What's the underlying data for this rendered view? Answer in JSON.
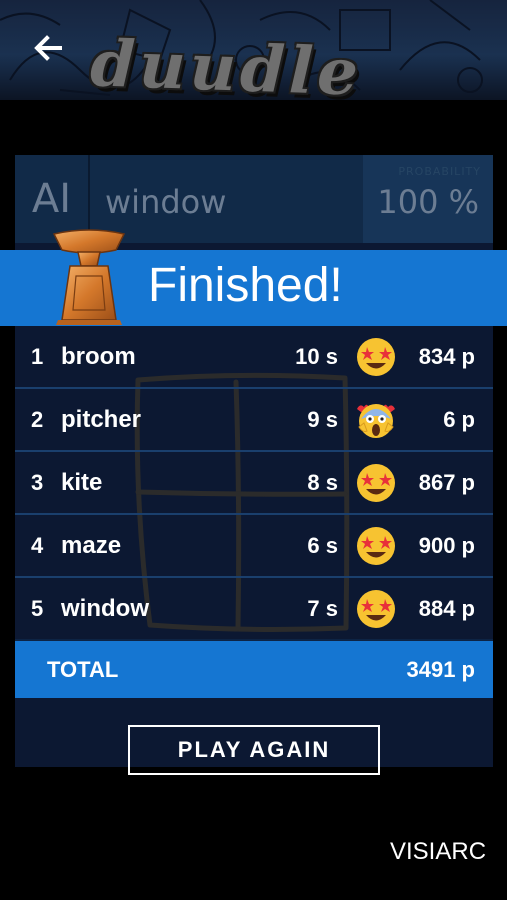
{
  "header": {
    "back_icon": "arrow-left-icon",
    "logo_text": "duudle"
  },
  "guess": {
    "ai_label": "AI",
    "word_label": "",
    "word": "window",
    "probability_label": "PROBABILITY",
    "probability": "100 %"
  },
  "banner": {
    "title": "Finished!",
    "icon": "trophy-icon"
  },
  "results": [
    {
      "rank": "1",
      "word": "broom",
      "time": "10 s",
      "emoji": "star-struck-emoji",
      "points": "834 p"
    },
    {
      "rank": "2",
      "word": "pitcher",
      "time": "9 s",
      "emoji": "screaming-face-emoji",
      "points": "6 p"
    },
    {
      "rank": "3",
      "word": "kite",
      "time": "8 s",
      "emoji": "star-struck-emoji",
      "points": "867 p"
    },
    {
      "rank": "4",
      "word": "maze",
      "time": "6 s",
      "emoji": "star-struck-emoji",
      "points": "900 p"
    },
    {
      "rank": "5",
      "word": "window",
      "time": "7 s",
      "emoji": "star-struck-emoji",
      "points": "884 p"
    }
  ],
  "total": {
    "label": "TOTAL",
    "value": "3491 p"
  },
  "actions": {
    "play_again": "PLAY AGAIN"
  },
  "footer": {
    "brand": "VISIARC"
  },
  "colors": {
    "accent_blue": "#1576d2",
    "board_bg": "#0c1832",
    "guess_bar_bg": "#112a48"
  }
}
